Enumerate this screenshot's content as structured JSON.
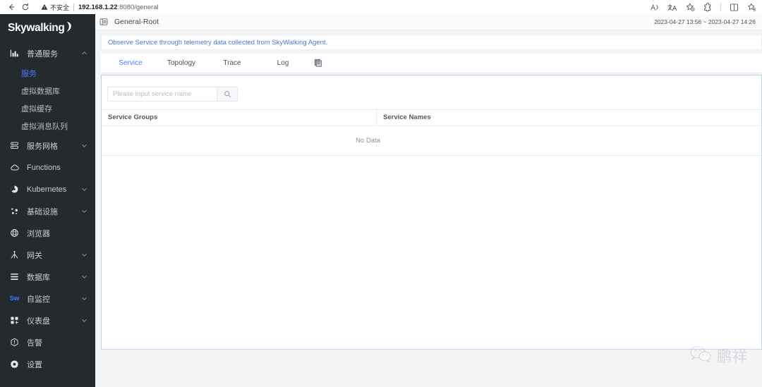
{
  "browser": {
    "back_label": "back-arrow",
    "reload_label": "reload",
    "security_warning": "不安全",
    "url_host": "192.168.1.22",
    "url_path": ":8080/general",
    "actions": [
      "read-aloud-icon",
      "translate-icon",
      "favorite-icon",
      "extensions-icon",
      "split-screen-icon",
      "collections-icon"
    ]
  },
  "sidebar": {
    "logo": "Skywalking",
    "items": [
      {
        "label": "普通服务",
        "icon": "bar-chart-icon",
        "expanded": true,
        "chevron": "up"
      },
      {
        "label": "服务网格",
        "icon": "server-stack-icon",
        "expanded": false,
        "chevron": "down"
      },
      {
        "label": "Functions",
        "icon": "cloud-icon",
        "expanded": false,
        "chevron": ""
      },
      {
        "label": "Kubernetes",
        "icon": "kubernetes-icon",
        "expanded": false,
        "chevron": "down"
      },
      {
        "label": "基础设施",
        "icon": "nodes-icon",
        "expanded": false,
        "chevron": "down"
      },
      {
        "label": "浏览器",
        "icon": "globe-icon",
        "expanded": false,
        "chevron": ""
      },
      {
        "label": "网关",
        "icon": "gateway-icon",
        "expanded": false,
        "chevron": "down"
      },
      {
        "label": "数据库",
        "icon": "database-list-icon",
        "expanded": false,
        "chevron": "down"
      },
      {
        "label": "自监控",
        "icon": "skywalking-sw-icon",
        "expanded": false,
        "chevron": "down"
      },
      {
        "label": "仪表盘",
        "icon": "dashboard-grid-icon",
        "expanded": false,
        "chevron": "down"
      },
      {
        "label": "告警",
        "icon": "alarm-bell-icon",
        "expanded": false,
        "chevron": ""
      },
      {
        "label": "设置",
        "icon": "gear-icon",
        "expanded": false,
        "chevron": ""
      }
    ],
    "subitems": [
      {
        "label": "服务",
        "active": true
      },
      {
        "label": "虚拟数据库",
        "active": false
      },
      {
        "label": "虚拟缓存",
        "active": false
      },
      {
        "label": "虚拟消息队列",
        "active": false
      }
    ],
    "active_color": "#4a7afc"
  },
  "topbar": {
    "collapse_icon": "collapse-sidebar-icon",
    "breadcrumb": "General-Root",
    "date_range": "2023-04-27 13:56 ~ 2023-04-27 14:26"
  },
  "banner": {
    "text": "Observe Service through telemetry data collected from SkyWalking Agent.",
    "color": "#4a78d6"
  },
  "tabs": [
    {
      "label": "Service",
      "active": true
    },
    {
      "label": "Topology",
      "active": false
    },
    {
      "label": "Trace",
      "active": false
    },
    {
      "label": "Log",
      "active": false
    }
  ],
  "tabs_action_icon": "copy-duplicate-icon",
  "search": {
    "placeholder": "Please input service name",
    "value": "",
    "button_icon": "search-icon"
  },
  "table": {
    "columns": [
      "Service Groups",
      "Service Names"
    ],
    "rows": [],
    "empty_text": "No Data"
  },
  "watermark": {
    "icon": "wechat-icon",
    "text": "鹏祥"
  }
}
